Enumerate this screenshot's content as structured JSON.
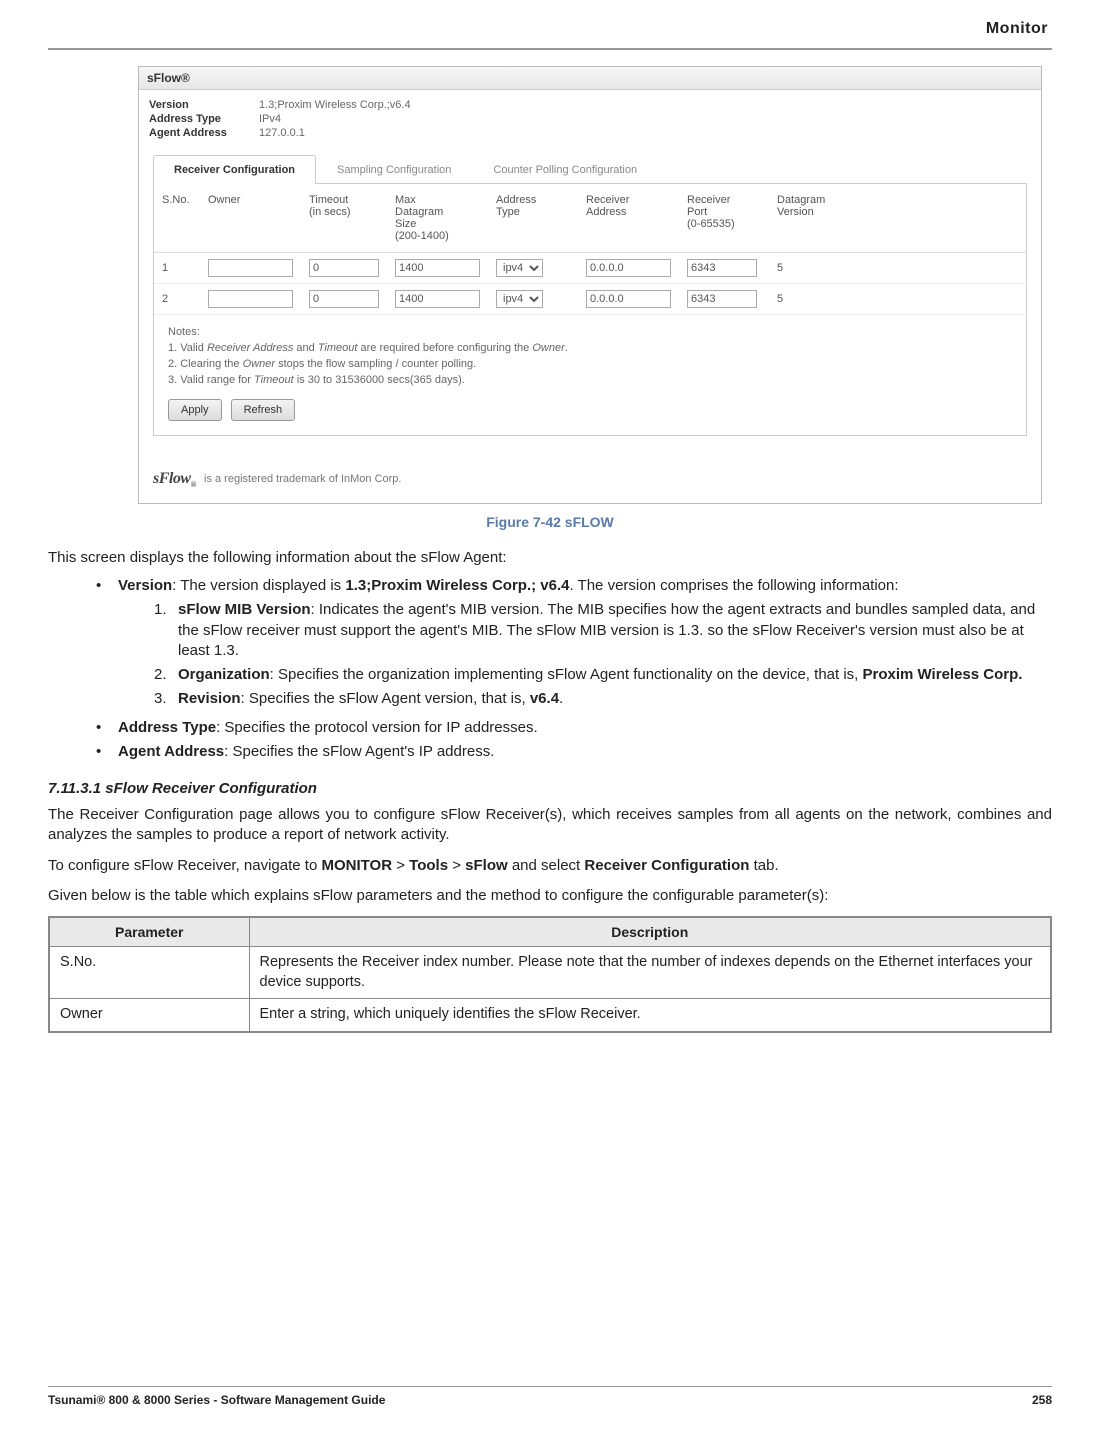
{
  "header": {
    "section": "Monitor"
  },
  "screenshot": {
    "title": "sFlow®",
    "info": {
      "version_label": "Version",
      "version_value": "1.3;Proxim Wireless Corp.;v6.4",
      "addrtype_label": "Address Type",
      "addrtype_value": "IPv4",
      "agentaddr_label": "Agent Address",
      "agentaddr_value": "127.0.0.1"
    },
    "tabs": {
      "t1": "Receiver Configuration",
      "t2": "Sampling Configuration",
      "t3": "Counter Polling Configuration"
    },
    "cols": {
      "sno": "S.No.",
      "owner": "Owner",
      "timeout": "Timeout\n(in secs)",
      "maxdg": "Max\nDatagram\nSize\n(200-1400)",
      "addrtype": "Address\nType",
      "recvaddr": "Receiver\nAddress",
      "recvport": "Receiver\nPort\n(0-65535)",
      "dgver": "Datagram\nVersion"
    },
    "rows": [
      {
        "sno": "1",
        "owner": "",
        "timeout": "0",
        "maxdg": "1400",
        "addrtype": "ipv4",
        "recvaddr": "0.0.0.0",
        "recvport": "6343",
        "dgver": "5"
      },
      {
        "sno": "2",
        "owner": "",
        "timeout": "0",
        "maxdg": "1400",
        "addrtype": "ipv4",
        "recvaddr": "0.0.0.0",
        "recvport": "6343",
        "dgver": "5"
      }
    ],
    "notes": {
      "header": "Notes:",
      "n1a": "1. Valid ",
      "n1b": "Receiver Address",
      "n1c": " and ",
      "n1d": "Timeout",
      "n1e": " are required before configuring the ",
      "n1f": "Owner",
      "n1g": ".",
      "n2a": "2. Clearing the ",
      "n2b": "Owner",
      "n2c": " stops the flow sampling / counter polling.",
      "n3a": "3. Valid range for ",
      "n3b": "Timeout",
      "n3c": " is 30 to 31536000 secs(365 days)."
    },
    "buttons": {
      "apply": "Apply",
      "refresh": "Refresh"
    },
    "trademark": {
      "logo": "sFlow",
      "reg": "®",
      "text": "is a registered trademark of InMon Corp."
    }
  },
  "figcaption": "Figure 7-42 sFLOW",
  "intro": "This screen displays the following information about the sFlow Agent:",
  "bullets": {
    "b1_label": "Version",
    "b1_a": ": The version displayed is ",
    "b1_bold": "1.3;Proxim Wireless Corp.; v6.4",
    "b1_b": ". The version comprises the following information:",
    "n1_label": "sFlow MIB Version",
    "n1_text": ": Indicates the agent's MIB version. The MIB specifies how the agent extracts and bundles sampled data, and the sFlow receiver must support the agent's MIB. The sFlow MIB version is 1.3. so the sFlow Receiver's version must also be at least 1.3.",
    "n2_label": "Organization",
    "n2_a": ": Specifies the organization implementing sFlow Agent functionality on the device, that is, ",
    "n2_bold": "Proxim Wireless Corp.",
    "n3_label": "Revision",
    "n3_a": ": Specifies the sFlow Agent version, that is, ",
    "n3_bold": "v6.4",
    "n3_b": ".",
    "b2_label": "Address Type",
    "b2_text": ": Specifies the protocol version for IP addresses.",
    "b3_label": "Agent Address",
    "b3_text": ": Specifies the sFlow Agent's IP address."
  },
  "section_heading": "7.11.3.1 sFlow Receiver Configuration",
  "para1": "The Receiver Configuration page allows you to configure sFlow Receiver(s), which receives samples from all agents on the network, combines and analyzes the samples to produce a report of network activity.",
  "para2_a": "To configure sFlow Receiver, navigate to ",
  "para2_b": "MONITOR",
  "para2_c": " > ",
  "para2_d": "Tools",
  "para2_e": " > ",
  "para2_f": "sFlow",
  "para2_g": " and select ",
  "para2_h": "Receiver Configuration",
  "para2_i": " tab.",
  "para3": "Given below is the table which explains sFlow parameters and the method to configure the configurable parameter(s):",
  "ptable": {
    "h1": "Parameter",
    "h2": "Description",
    "r1p": "S.No.",
    "r1d": "Represents the Receiver index number. Please note that the number of indexes depends on the Ethernet interfaces your device supports.",
    "r2p": "Owner",
    "r2d": "Enter a string, which uniquely identifies the sFlow Receiver."
  },
  "footer": {
    "left": "Tsunami® 800 & 8000 Series - Software Management Guide",
    "right": "258"
  }
}
